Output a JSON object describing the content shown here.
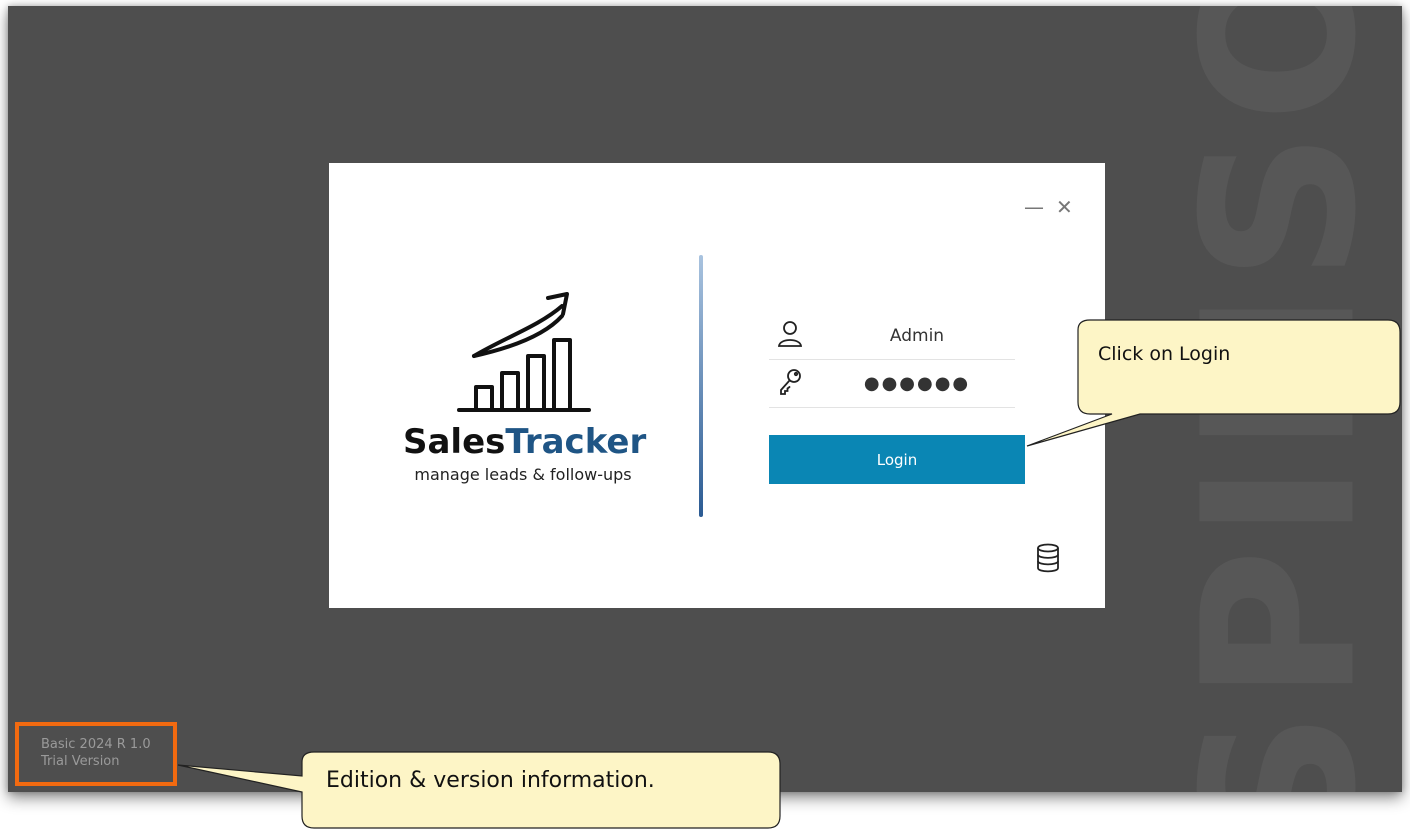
{
  "watermark": "SPIIISO",
  "version": {
    "edition": "Basic 2024 R 1.0",
    "license": "Trial Version"
  },
  "dialog": {
    "minimize_glyph": "—",
    "close_glyph": "✕",
    "brand": {
      "part1": "Sales",
      "part2": "Tracker",
      "tagline": "manage leads & follow-ups"
    },
    "username": {
      "icon": "user-icon",
      "value": "Admin"
    },
    "password": {
      "icon": "key-icon",
      "value": "●●●●●●"
    },
    "login_label": "Login",
    "database_icon": "database-icon",
    "colors": {
      "accent": "#0a86b4",
      "brand_blue": "#1f5585",
      "backdrop": "#4e4e4e",
      "highlight": "#f26a10"
    }
  },
  "callouts": {
    "login": "Click on Login",
    "edition": "Edition & version information."
  }
}
